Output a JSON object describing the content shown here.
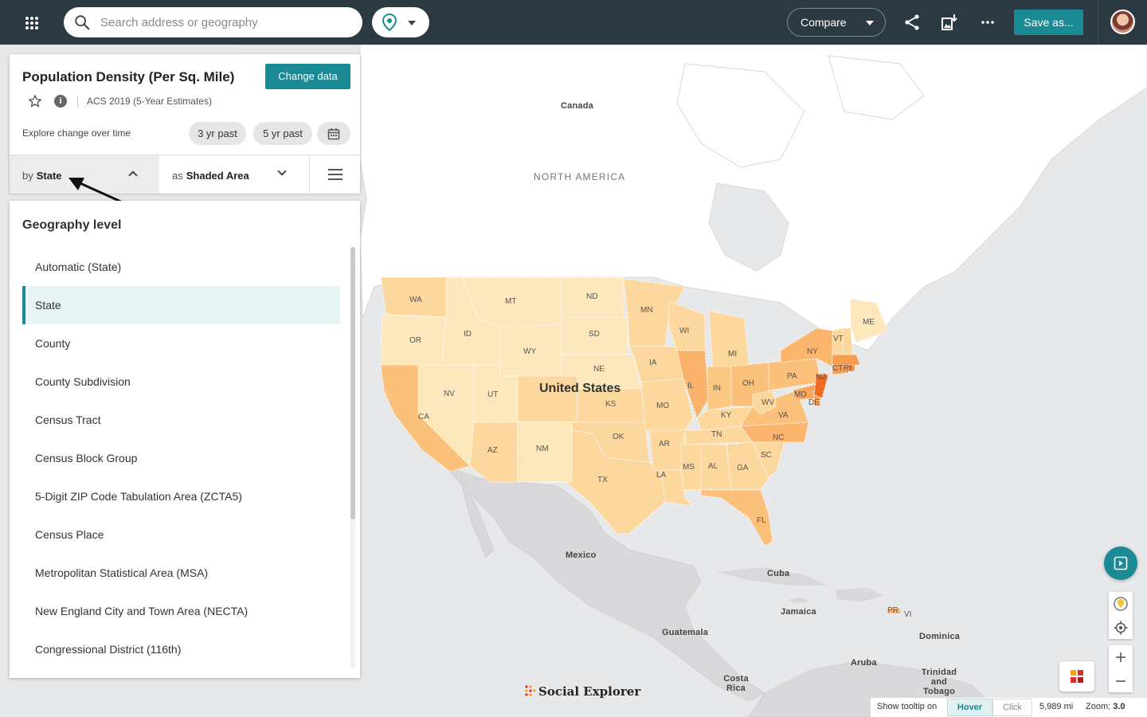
{
  "topbar": {
    "search_placeholder": "Search address or geography",
    "compare_label": "Compare",
    "save_label": "Save as..."
  },
  "panel": {
    "title": "Population Density (Per Sq. Mile)",
    "change_data_label": "Change data",
    "survey": "ACS 2019 (5-Year Estimates)",
    "explore_label": "Explore change over time",
    "pills": [
      "3 yr past",
      "5 yr past"
    ],
    "by_prefix": "by",
    "by_value": "State",
    "as_prefix": "as",
    "as_value": "Shaded Area"
  },
  "geography": {
    "heading": "Geography level",
    "selected": "State",
    "items": [
      "Automatic (State)",
      "State",
      "County",
      "County Subdivision",
      "Census Tract",
      "Census Block Group",
      "5-Digit ZIP Code Tabulation Area (ZCTA5)",
      "Census Place",
      "Metropolitan Statistical Area (MSA)",
      "New England City and Town Area (NECTA)",
      "Congressional District (116th)"
    ]
  },
  "map": {
    "labels": {
      "canada": "Canada",
      "north_america": "NORTH AMERICA",
      "united_states": "United States",
      "mexico": "Mexico",
      "cuba": "Cuba",
      "jamaica": "Jamaica",
      "guatemala": "Guatemala",
      "dominica": "Dominica",
      "aruba": "Aruba",
      "trinidad": "Trinidad and Tobago",
      "costa_rica": "Costa Rica",
      "pr": "PR",
      "vi": "VI"
    },
    "states": [
      "WA",
      "MT",
      "ND",
      "MN",
      "ME",
      "OR",
      "ID",
      "SD",
      "WI",
      "VT",
      "NY",
      "MI",
      "WY",
      "IA",
      "PA",
      "CT",
      "RI",
      "NJ",
      "NE",
      "IL",
      "OH",
      "IN",
      "NV",
      "UT",
      "CA",
      "KS",
      "MO",
      "MD",
      "DE",
      "WV",
      "KY",
      "VA",
      "OK",
      "TN",
      "NC",
      "AZ",
      "NM",
      "AR",
      "MS",
      "AL",
      "GA",
      "SC",
      "TX",
      "LA",
      "FL"
    ]
  },
  "statusbar": {
    "tooltip_label": "Show tooltip on",
    "hover_label": "Hover",
    "click_label": "Click",
    "scale": "5,989 mi",
    "zoom_label": "Zoom:",
    "zoom_value": "3.0"
  },
  "brand": "Social Explorer",
  "colors": {
    "topbar": "#2b3a42",
    "accent": "#1a8a94",
    "low": "#fde7bc",
    "mid": "#fbc883",
    "high": "#f79b4f",
    "highest": "#ef6b21"
  }
}
